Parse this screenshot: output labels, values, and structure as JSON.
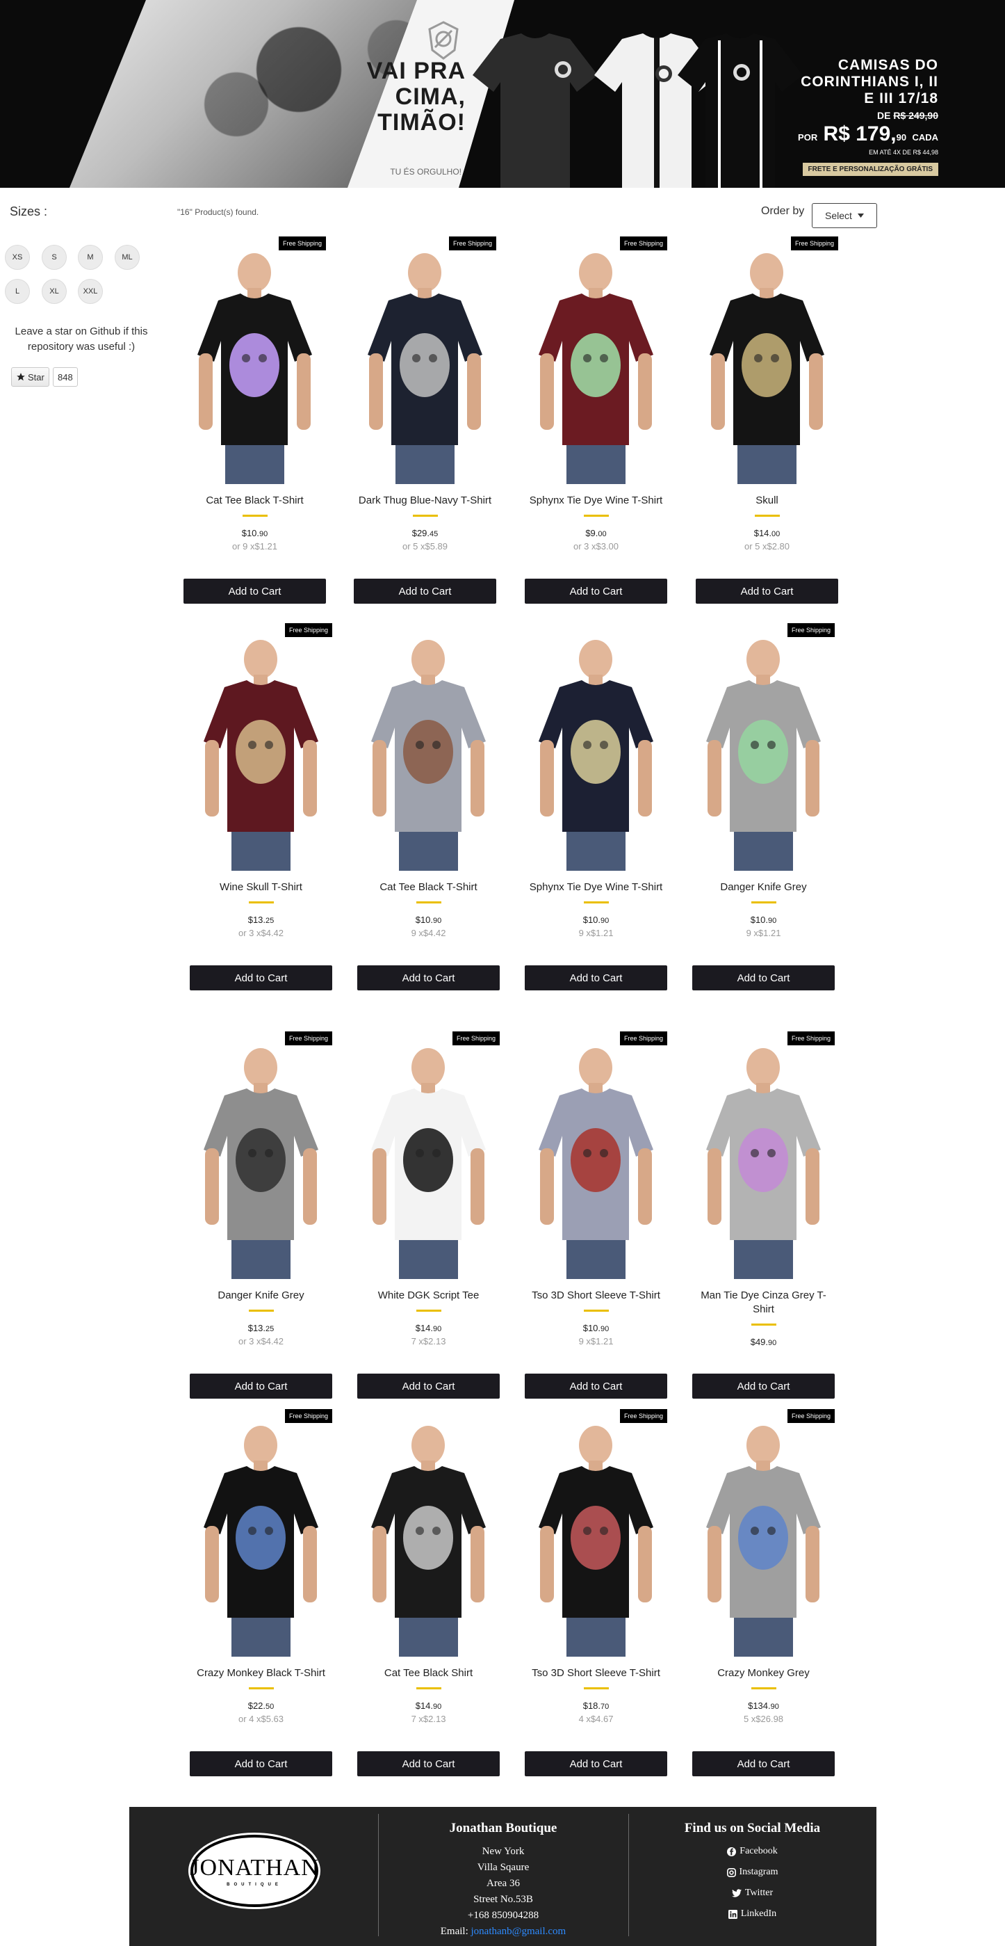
{
  "banner": {
    "slogan": "VAI PRA CIMA, TIMÃO!",
    "slogan_sub": "TU ÉS ORGULHO!",
    "promo_title": "CAMISAS DO CORINTHIANS I, II E III 17/18",
    "promo_old_prefix": "DE",
    "promo_old_price": "R$ 249,90",
    "promo_price_prefix": "POR",
    "promo_price": "R$ 179,",
    "promo_cents": "90",
    "promo_each": "CADA",
    "promo_installments": "EM ATÉ 4X DE R$ 44,98",
    "promo_badge": "FRETE E PERSONALIZAÇÃO GRÁTIS"
  },
  "sidebar": {
    "sizes_title": "Sizes :",
    "sizes": [
      "XS",
      "S",
      "M",
      "ML",
      "L",
      "XL",
      "XXL"
    ],
    "github_text": "Leave a star on Github if this repository was useful :)",
    "star_label": "Star",
    "star_count": "848"
  },
  "shelf": {
    "found": "\"16\" Product(s) found.",
    "order_label": "Order by",
    "order_select": "Select"
  },
  "products": [
    {
      "title": "Cat Tee Black T-Shirt",
      "price_int": "$10.",
      "price_cents": "90",
      "installment": "or 9 x$1.21",
      "free_shipping": true,
      "shirt_color": "#151515",
      "print_color": "#c7a0ff",
      "cart": "Add to Cart"
    },
    {
      "title": "Dark Thug Blue-Navy T-Shirt",
      "price_int": "$29.",
      "price_cents": "45",
      "installment": "or 5 x$5.89",
      "free_shipping": true,
      "shirt_color": "#1d2230",
      "print_color": "#bfbfbf",
      "cart": "Add to Cart"
    },
    {
      "title": "Sphynx Tie Dye Wine T-Shirt",
      "price_int": "$9.",
      "price_cents": "00",
      "installment": "or 3 x$3.00",
      "free_shipping": true,
      "shirt_color": "#6b1b22",
      "print_color": "#9fe0a8",
      "cart": "Add to Cart"
    },
    {
      "title": "Skull",
      "price_int": "$14.",
      "price_cents": "00",
      "installment": "or 5 x$2.80",
      "free_shipping": true,
      "shirt_color": "#141414",
      "print_color": "#c9b47a",
      "cart": "Add to Cart"
    },
    {
      "title": "Wine Skull T-Shirt",
      "price_int": "$13.",
      "price_cents": "25",
      "installment": "or 3 x$4.42",
      "free_shipping": true,
      "shirt_color": "#5e1820",
      "print_color": "#d3b98a",
      "cart": "Add to Cart"
    },
    {
      "title": "Cat Tee Black T-Shirt",
      "price_int": "$10.",
      "price_cents": "90",
      "installment": "9 x$4.42",
      "free_shipping": false,
      "shirt_color": "#9ea2ad",
      "print_color": "#8a5a44",
      "cart": "Add to Cart"
    },
    {
      "title": "Sphynx Tie Dye Wine T-Shirt",
      "price_int": "$10.",
      "price_cents": "90",
      "installment": "9 x$1.21",
      "free_shipping": false,
      "shirt_color": "#1c2033",
      "print_color": "#d9cf9a",
      "cart": "Add to Cart"
    },
    {
      "title": "Danger Knife Grey",
      "price_int": "$10.",
      "price_cents": "90",
      "installment": "9 x$1.21",
      "free_shipping": true,
      "shirt_color": "#a3a3a3",
      "print_color": "#95d6a0",
      "cart": "Add to Cart"
    },
    {
      "title": "Danger Knife Grey",
      "price_int": "$13.",
      "price_cents": "25",
      "installment": "or 3 x$4.42",
      "free_shipping": true,
      "shirt_color": "#8e8e8e",
      "print_color": "#303030",
      "cart": "Add to Cart"
    },
    {
      "title": "White DGK Script Tee",
      "price_int": "$14.",
      "price_cents": "90",
      "installment": "7 x$2.13",
      "free_shipping": true,
      "shirt_color": "#f3f3f3",
      "print_color": "#111111",
      "cart": "Add to Cart"
    },
    {
      "title": "Tso 3D Short Sleeve T-Shirt",
      "price_int": "$10.",
      "price_cents": "90",
      "installment": "9 x$1.21",
      "free_shipping": true,
      "shirt_color": "#9b9fb4",
      "print_color": "#a8322c",
      "cart": "Add to Cart"
    },
    {
      "title": "Man Tie Dye Cinza Grey T-Shirt",
      "price_int": "$49.",
      "price_cents": "90",
      "installment": "",
      "free_shipping": true,
      "shirt_color": "#b3b3b3",
      "print_color": "#c38ad6",
      "cart": "Add to Cart"
    },
    {
      "title": "Crazy Monkey Black T-Shirt",
      "price_int": "$22.",
      "price_cents": "50",
      "installment": "or 4 x$5.63",
      "free_shipping": true,
      "shirt_color": "#121212",
      "print_color": "#5e84c9",
      "cart": "Add to Cart"
    },
    {
      "title": "Cat Tee Black Shirt",
      "price_int": "$14.",
      "price_cents": "90",
      "installment": "7 x$2.13",
      "free_shipping": false,
      "shirt_color": "#1a1a1a",
      "print_color": "#c9c9c9",
      "cart": "Add to Cart"
    },
    {
      "title": "Tso 3D Short Sleeve T-Shirt",
      "price_int": "$18.",
      "price_cents": "70",
      "installment": "4 x$4.67",
      "free_shipping": true,
      "shirt_color": "#141414",
      "print_color": "#c4585a",
      "cart": "Add to Cart"
    },
    {
      "title": "Crazy Monkey Grey",
      "price_int": "$134.",
      "price_cents": "90",
      "installment": "5 x$26.98",
      "free_shipping": true,
      "shirt_color": "#9f9f9f",
      "print_color": "#5e84c9",
      "cart": "Add to Cart"
    }
  ],
  "free_shipping_label": "Free Shipping",
  "footer": {
    "logo_text": "JONATHAN",
    "logo_sub": "BOUTIQUE",
    "store_title": "Jonathan Boutique",
    "address": [
      "New York",
      "Villa Sqaure",
      "Area 36",
      "Street No.53B",
      "+168 850904288"
    ],
    "email_label": "Email:",
    "email": "jonathanb@gmail.com",
    "social_title": "Find us on Social Media",
    "social": [
      "Facebook",
      "Instagram",
      "Twitter",
      "LinkedIn"
    ]
  },
  "colors": {
    "accent_rule": "#eabf00",
    "button": "#1b1a20",
    "footer": "#232323",
    "link": "#2e8bff"
  }
}
